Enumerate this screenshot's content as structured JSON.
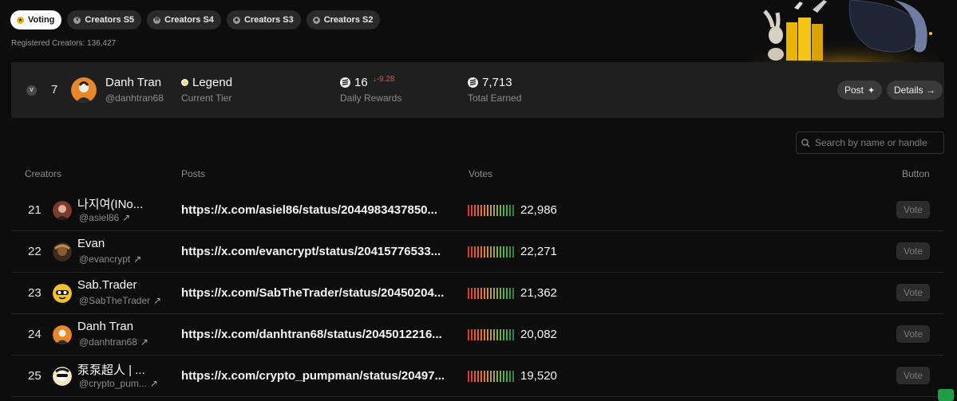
{
  "tabs": [
    {
      "label": "Voting",
      "active": true,
      "icon": "star-icon"
    },
    {
      "label": "Creators S5",
      "icon": "token-icon"
    },
    {
      "label": "Creators S4",
      "icon": "token-icon"
    },
    {
      "label": "Creators S3",
      "icon": "token-icon"
    },
    {
      "label": "Creators S2",
      "icon": "token-icon"
    }
  ],
  "registered_creators": "Registered Creators: 136,427",
  "me": {
    "badge": "V",
    "rank": "7",
    "name": "Danh Tran",
    "handle": "@danhtran68",
    "tier_value": "Legend",
    "tier_label": "Current Tier",
    "daily_rewards_value": "16",
    "daily_rewards_delta": "↓-9.28",
    "daily_rewards_label": "Daily Rewards",
    "total_earned_value": "7,713",
    "total_earned_label": "Total Earned",
    "post_button": "Post",
    "details_button": "Details →"
  },
  "search": {
    "placeholder": "Search by name or handle"
  },
  "columns": {
    "creators": "Creators",
    "posts": "Posts",
    "votes": "Votes",
    "button": "Button"
  },
  "rows": [
    {
      "rank": "21",
      "name": "나지여(INo...",
      "handle": "@asiel86",
      "post": "https://x.com/asiel86/status/2044983437850...",
      "votes": "22,986",
      "button": "Vote",
      "avatar_color": "#7a3b2a"
    },
    {
      "rank": "22",
      "name": "Evan",
      "handle": "@evancrypt",
      "post": "https://x.com/evancrypt/status/20415776533...",
      "votes": "22,271",
      "button": "Vote",
      "avatar_color": "#6b4a2e"
    },
    {
      "rank": "23",
      "name": "Sab.Trader",
      "handle": "@SabTheTrader",
      "post": "https://x.com/SabTheTrader/status/20450204...",
      "votes": "21,362",
      "button": "Vote",
      "avatar_color": "#f2c12e"
    },
    {
      "rank": "24",
      "name": "Danh Tran",
      "handle": "@danhtran68",
      "post": "https://x.com/danhtran68/status/2045012216...",
      "votes": "20,082",
      "button": "Vote",
      "avatar_color": "#e8862a"
    },
    {
      "rank": "25",
      "name": "泵泵超人 | ...",
      "handle": "@crypto_pum...",
      "post": "https://x.com/crypto_pumpman/status/20497...",
      "votes": "19,520",
      "button": "Vote",
      "avatar_color": "#d9c9a0"
    }
  ]
}
